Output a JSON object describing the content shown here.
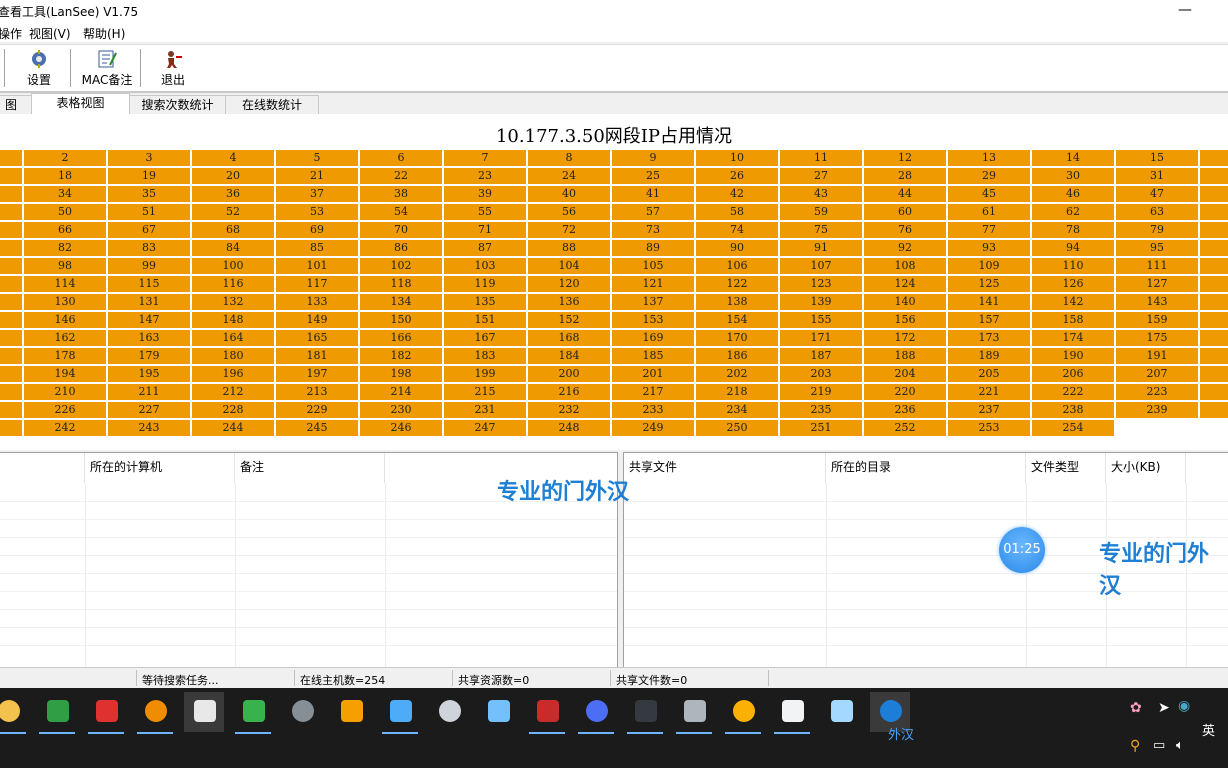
{
  "window": {
    "title": "查看工具(LanSee) V1.75",
    "minimize": "—"
  },
  "menu": [
    "操作",
    "视图(V)",
    "帮助(H)"
  ],
  "toolbar": {
    "settings": "设置",
    "mac_note": "MAC备注",
    "exit": "退出"
  },
  "tabs": [
    "图",
    "表格视图",
    "搜索次数统计",
    "在线数统计"
  ],
  "main": {
    "heading": "10.177.3.50网段IP占用情况"
  },
  "left_table": {
    "columns": [
      "",
      "所在的计算机",
      "备注"
    ]
  },
  "right_table": {
    "columns": [
      "共享文件",
      "所在的目录",
      "文件类型",
      "大小(KB)"
    ]
  },
  "watermark": {
    "left": "专业的门外汉",
    "right": "专业的门外汉"
  },
  "timer": "01:25",
  "status": {
    "waiting": "等待搜索任务...",
    "online_hosts": "在线主机数=254",
    "shared_resources": "共享资源数=0",
    "shared_files": "共享文件数=0"
  },
  "taskbar": {
    "active_label": "外汉",
    "tray_lang": "英",
    "icons": [
      "folder-icon",
      "ie-icon",
      "media-icon",
      "search-tool-icon",
      "chrome-icon",
      "play-icon",
      "chip-icon",
      "archive-icon",
      "network-icon",
      "file-icon",
      "puzzle-icon",
      "red-m-icon",
      "monitor-icon",
      "terminal-icon",
      "books-icon",
      "ftp-icon",
      "gear-icon",
      "glass-icon",
      "lansee-icon"
    ]
  },
  "ip_grid": {
    "first_visible_col": 2,
    "last": 254,
    "per_row": 16
  }
}
